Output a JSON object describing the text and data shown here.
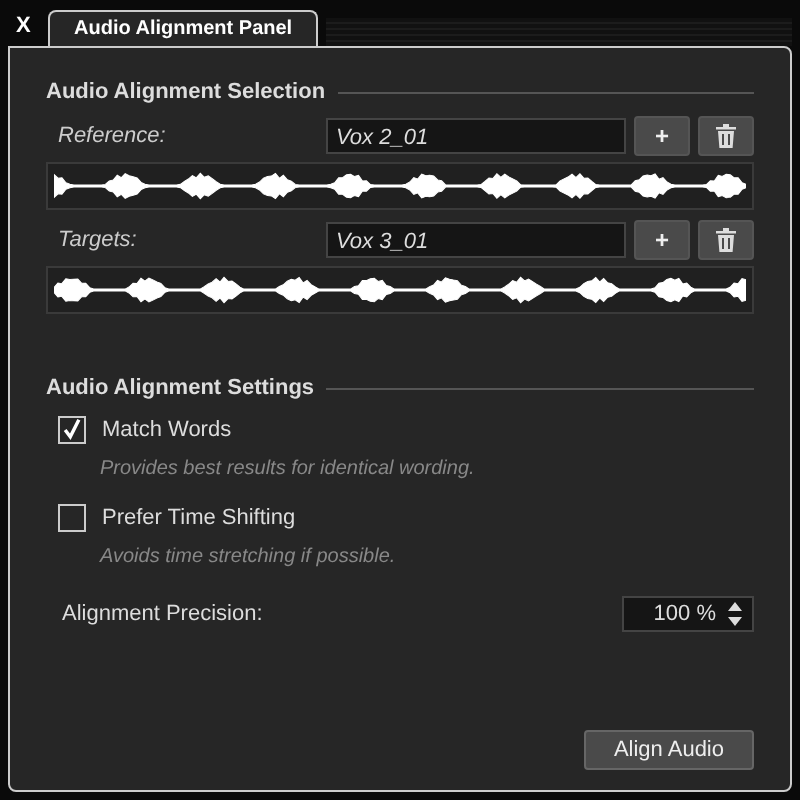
{
  "close_label": "X",
  "tab": {
    "label": "Audio Alignment Panel",
    "selected": true
  },
  "selection": {
    "title": "Audio Alignment Selection",
    "rows": [
      {
        "label": "Reference:",
        "value": "Vox 2_01",
        "add": "+"
      },
      {
        "label": "Targets:",
        "value": "Vox 3_01",
        "add": "+"
      }
    ]
  },
  "settings": {
    "title": "Audio Alignment Settings",
    "options": [
      {
        "label": "Match Words",
        "checked": true,
        "hint": "Provides best results for identical wording."
      },
      {
        "label": "Prefer Time Shifting",
        "checked": false,
        "hint": "Avoids time stretching if possible."
      }
    ],
    "precision": {
      "label": "Alignment Precision:",
      "value": "100 %"
    }
  },
  "button": "Align Audio"
}
